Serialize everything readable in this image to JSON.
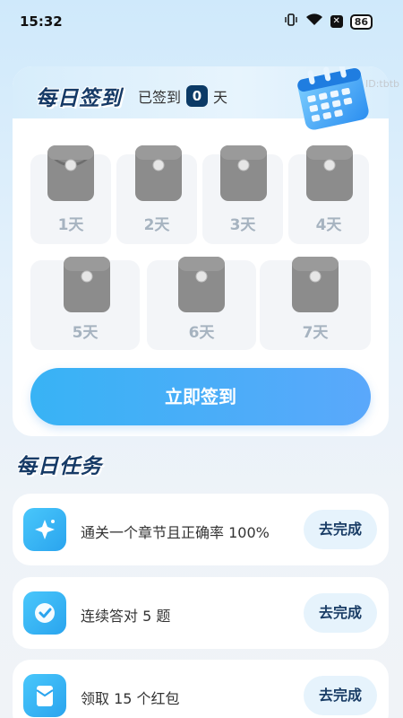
{
  "status_bar": {
    "time": "15:32",
    "battery": "86",
    "icons": [
      "vibrate-icon",
      "wifi-icon",
      "close-badge-icon",
      "battery-icon"
    ]
  },
  "signin_card": {
    "title": "每日签到",
    "signed_prefix": "已签到",
    "signed_count": "0",
    "signed_suffix": "天",
    "id_text": "ID:tbtb",
    "days": [
      {
        "label": "1天"
      },
      {
        "label": "2天"
      },
      {
        "label": "3天"
      },
      {
        "label": "4天"
      },
      {
        "label": "5天"
      },
      {
        "label": "6天"
      },
      {
        "label": "7天"
      }
    ],
    "button_label": "立即签到"
  },
  "tasks_section": {
    "title": "每日任务",
    "tasks": [
      {
        "text": "通关一个章节且正确率 100%",
        "button": "去完成",
        "icon": "sparkle-icon"
      },
      {
        "text": "连续答对 5 题",
        "button": "去完成",
        "icon": "check-circle-icon"
      },
      {
        "text": "领取 15 个红包",
        "button": "去完成",
        "icon": "envelope-icon"
      }
    ]
  },
  "colors": {
    "accent": "#38b3f5",
    "title": "#163a66",
    "badge": "#0b3a66",
    "day_label": "#a6b3c0"
  }
}
